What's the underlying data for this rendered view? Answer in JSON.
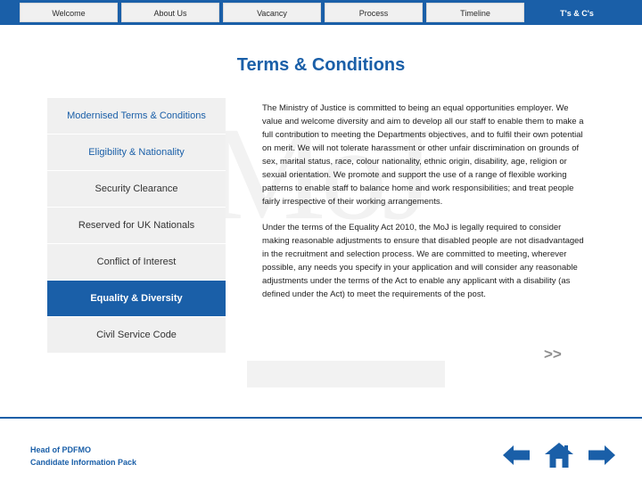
{
  "topnav": {
    "tabs": [
      {
        "label": "Welcome",
        "active": false
      },
      {
        "label": "About Us",
        "active": false
      },
      {
        "label": "Vacancy",
        "active": false
      },
      {
        "label": "Process",
        "active": false
      },
      {
        "label": "Timeline",
        "active": false
      },
      {
        "label": "T's & C's",
        "active": true
      }
    ]
  },
  "watermark": {
    "text": "MoJ"
  },
  "page": {
    "title": "Terms & Conditions"
  },
  "menu": {
    "items": [
      {
        "label": "Modernised Terms & Conditions",
        "selected": false
      },
      {
        "label": "Eligibility & Nationality",
        "selected": false
      },
      {
        "label": "Security Clearance",
        "selected": false
      },
      {
        "label": "Reserved for UK Nationals",
        "selected": false
      },
      {
        "label": "Conflict of Interest",
        "selected": false
      },
      {
        "label": "Equality & Diversity",
        "selected": true
      },
      {
        "label": "Civil Service Code",
        "selected": false
      }
    ]
  },
  "content": {
    "paragraphs": [
      "The Ministry of Justice is committed to being an equal opportunities employer.  We value and welcome diversity and aim to develop all our staff to enable them to make a full contribution to meeting the Departments objectives, and to fulfil their own potential on merit.  We will not tolerate harassment or other unfair discrimination on grounds of sex, marital status, race, colour nationality, ethnic origin, disability, age, religion or sexual orientation. We promote and support the use of a range of flexible working patterns to enable staff to balance home and work responsibilities; and treat people fairly irrespective of their working arrangements.",
      "Under the terms of the Equality Act 2010, the MoJ is legally required to consider making reasonable adjustments to ensure that disabled people are not disadvantaged in the recruitment and selection process. We are committed to meeting, wherever possible, any needs you specify in your application and will consider any reasonable adjustments under the terms of the Act to enable any applicant with a disability (as defined under the Act) to meet the requirements of the post."
    ],
    "more_indicator": ">>"
  },
  "footer": {
    "line1": "Head of PDFMO",
    "line2": "Candidate Information Pack",
    "nav": {
      "back": "back-arrow-icon",
      "home": "home-icon",
      "forward": "forward-arrow-icon"
    },
    "accent_color": "#1a5fa8"
  }
}
